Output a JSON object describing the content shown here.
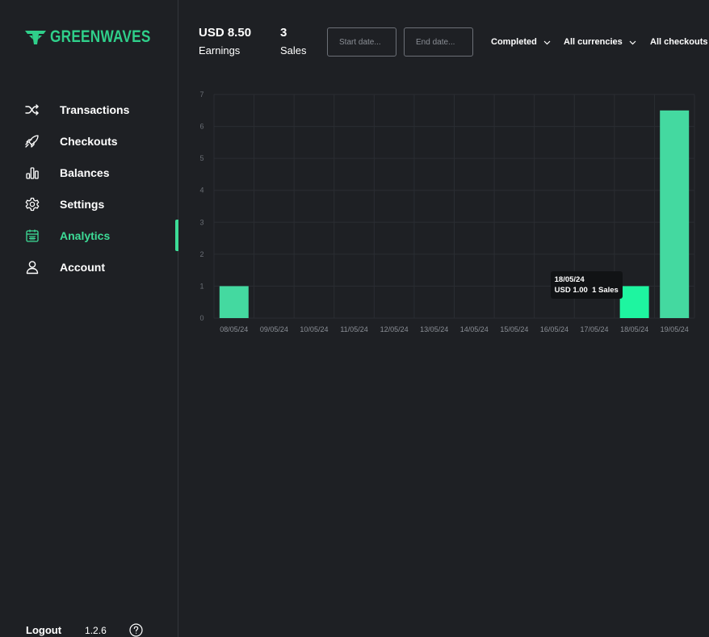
{
  "app": {
    "name": "GREENWAVES",
    "version": "1.2.6"
  },
  "sidebar": {
    "items": [
      {
        "label": "Transactions",
        "icon": "shuffle-icon",
        "active": false
      },
      {
        "label": "Checkouts",
        "icon": "rocket-icon",
        "active": false
      },
      {
        "label": "Balances",
        "icon": "bar-chart-icon",
        "active": false
      },
      {
        "label": "Settings",
        "icon": "gear-icon",
        "active": false
      },
      {
        "label": "Analytics",
        "icon": "calendar-icon",
        "active": true
      },
      {
        "label": "Account",
        "icon": "user-icon",
        "active": false
      }
    ],
    "logout_label": "Logout"
  },
  "header": {
    "earnings_value": "USD 8.50",
    "earnings_label": "Earnings",
    "sales_value": "3",
    "sales_label": "Sales",
    "start_date_placeholder": "Start date...",
    "end_date_placeholder": "End date...",
    "status_filter": "Completed",
    "currency_filter": "All currencies",
    "checkout_filter": "All checkouts"
  },
  "colors": {
    "accent": "#3ddc97",
    "bar": "#44d9a0",
    "bar_highlight": "#1ef5a0",
    "background": "#1e2024"
  },
  "chart_data": {
    "type": "bar",
    "categories": [
      "08/05/24",
      "09/05/24",
      "10/05/24",
      "11/05/24",
      "12/05/24",
      "13/05/24",
      "14/05/24",
      "15/05/24",
      "16/05/24",
      "17/05/24",
      "18/05/24",
      "19/05/24"
    ],
    "values": [
      1,
      0,
      0,
      0,
      0,
      0,
      0,
      0,
      0,
      0,
      1,
      6.5
    ],
    "ylim": [
      0,
      7
    ],
    "yticks": [
      0,
      1,
      2,
      3,
      4,
      5,
      6,
      7
    ],
    "grid": true,
    "highlighted_index": 10,
    "tooltip": {
      "date": "18/05/24",
      "amount": "USD 1.00",
      "sales": "1 Sales"
    }
  }
}
